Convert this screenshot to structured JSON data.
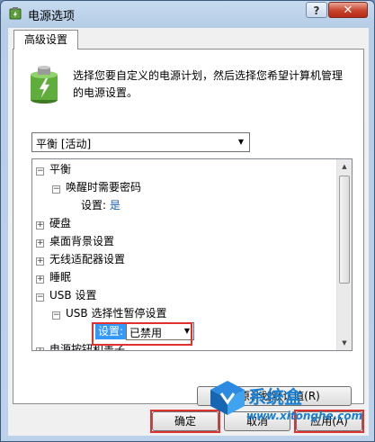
{
  "window": {
    "title": "电源选项",
    "help_label": "?",
    "close_label": "✕"
  },
  "tab": {
    "label": "高级设置"
  },
  "description": "选择您要自定义的电源计划，然后选择您希望计算机管理的电源设置。",
  "plan_select": {
    "value": "平衡 [活动]"
  },
  "tree": {
    "balanced": {
      "toggle": "−",
      "label": "平衡"
    },
    "wake_password": {
      "toggle": "−",
      "label": "唤醒时需要密码"
    },
    "wake_setting": {
      "label": "设置:",
      "value": "是"
    },
    "disk": {
      "toggle": "+",
      "label": "硬盘"
    },
    "desktop_bg": {
      "toggle": "+",
      "label": "桌面背景设置"
    },
    "wireless": {
      "toggle": "+",
      "label": "无线适配器设置"
    },
    "sleep": {
      "toggle": "+",
      "label": "睡眠"
    },
    "usb": {
      "toggle": "−",
      "label": "USB 设置"
    },
    "usb_suspend": {
      "toggle": "−",
      "label": "USB 选择性暂停设置"
    },
    "usb_setting": {
      "label": "设置:",
      "value": "已禁用"
    },
    "power_buttons": {
      "toggle": "+",
      "label": "电源按钮和盖子"
    }
  },
  "buttons": {
    "restore": "还原计划默认值(R)",
    "ok": "确定",
    "cancel": "取消",
    "apply": "应用(A)"
  },
  "watermark": {
    "text": "系统盒",
    "url": "www.xitonghe.com"
  },
  "colors": {
    "highlight": "#3399ff",
    "annotation_red": "#e03030",
    "link": "#1a5fb4"
  }
}
